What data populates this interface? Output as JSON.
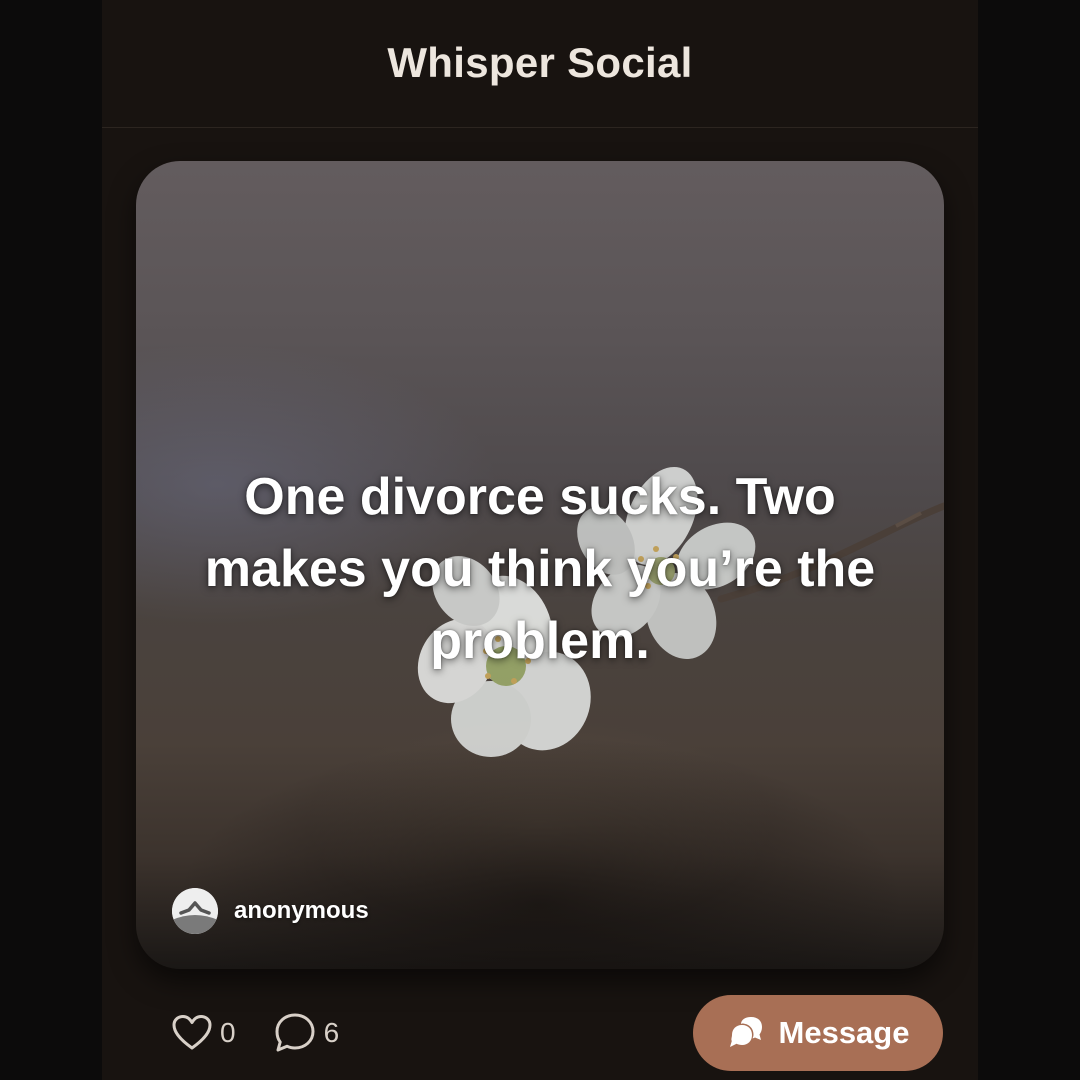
{
  "header": {
    "title": "Whisper Social"
  },
  "post": {
    "text": "One divorce sucks. Two makes you think you’re the problem.",
    "author": "anonymous",
    "likes": "0",
    "comments": "6"
  },
  "actions": {
    "message_label": "Message"
  },
  "colors": {
    "background": "#0c0b0b",
    "panel": "#181310",
    "accent": "#a86f55",
    "text": "#ede6de"
  },
  "icons": {
    "like": "heart-outline-icon",
    "comment": "speech-bubble-icon",
    "message": "chat-bubbles-icon"
  }
}
